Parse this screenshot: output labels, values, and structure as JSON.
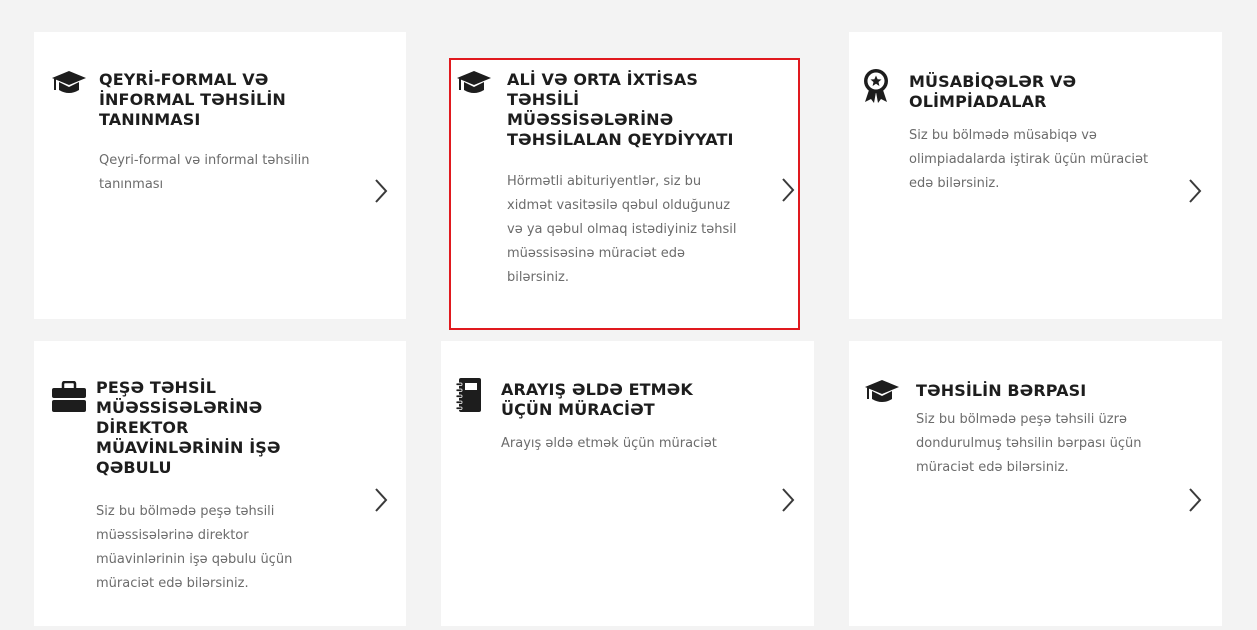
{
  "cards": [
    {
      "title": "QEYRİ-FORMAL VƏ İNFORMAL TƏHSİLİN TANINMASI",
      "description": "Qeyri-formal və informal təhsilin tanınması",
      "icon": "graduation-cap-icon"
    },
    {
      "title": "ALİ VƏ ORTA İXTİSAS TƏHSİLİ MÜƏSSİSƏLƏRİNƏ TƏHSİLALAN QEYDİYYATI",
      "description": "Hörmətli abituriyentlər, siz bu xidmət vasitəsilə qəbul olduğunuz və ya qəbul olmaq istədiyiniz təhsil müəssisəsinə müraciət edə bilərsiniz.",
      "icon": "graduation-cap-icon",
      "highlighted": true
    },
    {
      "title": "MÜSABİQƏLƏR VƏ OLİMPİADALAR",
      "description": "Siz bu bölmədə müsabiqə və olimpiadalarda iştirak üçün müraciət edə bilərsiniz.",
      "icon": "award-medal-icon"
    },
    {
      "title": "PEŞƏ TƏHSİL MÜƏSSİSƏLƏRİNƏ DİREKTOR MÜAVİNLƏRİNİN İŞƏ QƏBULU",
      "description": "Siz bu bölmədə peşə təhsili müəssisələrinə direktor müavinlərinin işə qəbulu üçün müraciət edə bilərsiniz.",
      "icon": "briefcase-icon"
    },
    {
      "title": "ARAYIŞ ƏLDƏ ETMƏK ÜÇÜN MÜRACİƏT",
      "description": "Arayış əldə etmək üçün müraciət",
      "icon": "notebook-icon"
    },
    {
      "title": "TƏHSİLİN BƏRPASI",
      "description": "Siz bu bölmədə peşə təhsili üzrə dondurulmuş təhsilin bərpası üçün müraciət edə bilərsiniz.",
      "icon": "graduation-cap-icon"
    }
  ],
  "colors": {
    "background": "#f3f3f3",
    "card": "#ffffff",
    "highlight_border": "#e0191e",
    "title": "#1d1d1d",
    "description": "#6c6c6c"
  }
}
